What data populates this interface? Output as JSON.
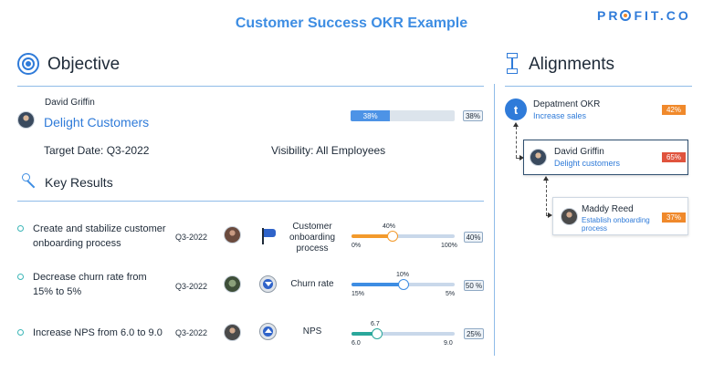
{
  "header": {
    "title": "Customer Success OKR Example",
    "logo_left": "PR",
    "logo_right": "FIT.CO"
  },
  "objective": {
    "section_title": "Objective",
    "owner": "David Griffin",
    "name": "Delight Customers",
    "progress_bar_label": "38%",
    "progress_badge": "38%",
    "progress": 0.38,
    "target_date_label": "Target Date:",
    "target_date": "Q3-2022",
    "visibility_label": "Visibility:",
    "visibility": "All Employees"
  },
  "key_results": {
    "section_title": "Key Results",
    "items": [
      {
        "text_line1": "Create and stabilize customer",
        "text_line2": "onboarding process",
        "quarter": "Q3-2022",
        "metric_icon": "flag-icon",
        "metric_line1": "Customer",
        "metric_line2": "onboarding",
        "metric_line3": "process",
        "current": "40%",
        "start": "0%",
        "target": "100%",
        "progress": 0.4,
        "badge": "40%",
        "color": "#f39a2b"
      },
      {
        "text_line1": "Decrease churn rate from",
        "text_line2": "15% to 5%",
        "quarter": "Q3-2022",
        "metric_icon": "arrow-down-circle-icon",
        "metric_line1": "Churn rate",
        "current": "10%",
        "start": "15%",
        "target": "5%",
        "progress": 0.5,
        "badge": "50 %",
        "color": "#3d8de3"
      },
      {
        "text_line1": "Increase NPS from 6.0 to 9.0",
        "quarter": "Q3-2022",
        "metric_icon": "arrow-up-circle-icon",
        "metric_line1": "NPS",
        "current": "6.7",
        "start": "6.0",
        "target": "9.0",
        "progress": 0.25,
        "badge": "25%",
        "color": "#2aa79b"
      }
    ]
  },
  "alignments": {
    "section_title": "Alignments",
    "department": {
      "title": "Depatment OKR",
      "subtitle": "Increase sales",
      "badge": "42%",
      "badge_color": "#f0892b"
    },
    "owner_card": {
      "name": "David Griffin",
      "subtitle": "Delight customers",
      "badge": "65%",
      "badge_color": "#e0533d"
    },
    "child_card": {
      "name": "Maddy Reed",
      "subtitle_line1": "Establish onboarding",
      "subtitle_line2": "process",
      "badge": "37%",
      "badge_color": "#f0892b"
    }
  }
}
